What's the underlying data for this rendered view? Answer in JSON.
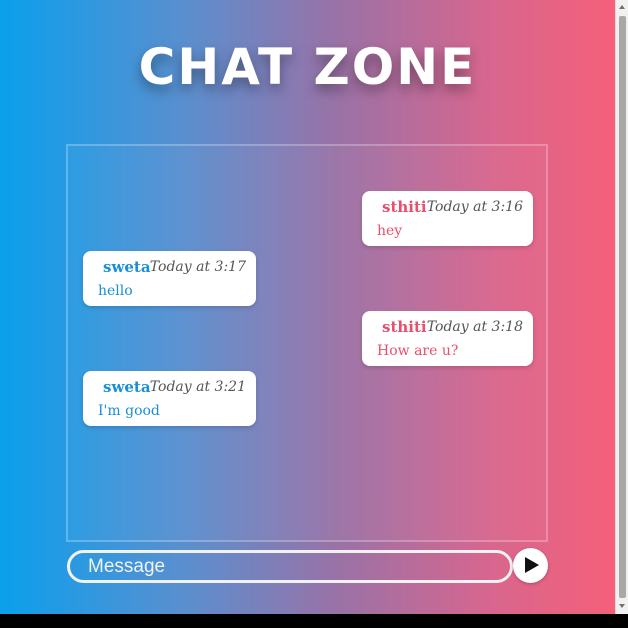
{
  "title": "CHAT ZONE",
  "messages": [
    {
      "side": "right",
      "sender": "sthiti",
      "time": "Today at 3:16",
      "text": "hey"
    },
    {
      "side": "left",
      "sender": "sweta",
      "time": "Today at 3:17",
      "text": "hello"
    },
    {
      "side": "right",
      "sender": "sthiti",
      "time": "Today at 3:18",
      "text": "How are u?"
    },
    {
      "side": "left",
      "sender": "sweta",
      "time": "Today at 3:21",
      "text": "I'm good"
    }
  ],
  "input": {
    "placeholder": "Message",
    "value": ""
  },
  "send_button": {
    "icon": "play-icon"
  },
  "colors": {
    "gradient_left": "#0aa0ec",
    "gradient_right": "#f5607a",
    "sender_left": "#1a8fd6",
    "sender_right": "#e84f6c"
  }
}
